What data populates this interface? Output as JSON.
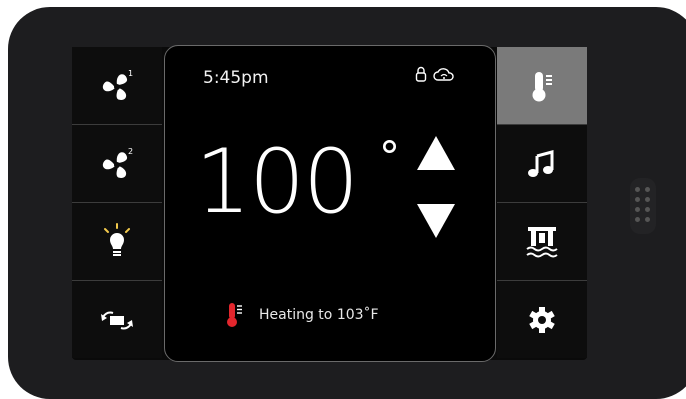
{
  "screen": {
    "time": "5:45pm",
    "temperature": "100",
    "degree_symbol": "°",
    "status": "Heating to 103˚F"
  },
  "left_buttons": [
    {
      "name": "fan-1",
      "icon": "fan-1-icon"
    },
    {
      "name": "fan-2",
      "icon": "fan-2-icon"
    },
    {
      "name": "light",
      "icon": "lightbulb-icon"
    },
    {
      "name": "mode-cycle",
      "icon": "cycle-arrows-icon"
    }
  ],
  "right_buttons": [
    {
      "name": "temperature",
      "icon": "thermometer-icon",
      "active": true
    },
    {
      "name": "music",
      "icon": "music-note-icon",
      "active": false
    },
    {
      "name": "water-feature",
      "icon": "pool-icon",
      "active": false
    },
    {
      "name": "settings",
      "icon": "gear-icon",
      "active": false
    }
  ],
  "labels": {
    "fan_1_badge": "1",
    "fan_2_badge": "2"
  },
  "colors": {
    "background": "#000000",
    "active_button": "#7a7a7a",
    "heating_red": "#e3262d",
    "text": "#ffffff"
  }
}
